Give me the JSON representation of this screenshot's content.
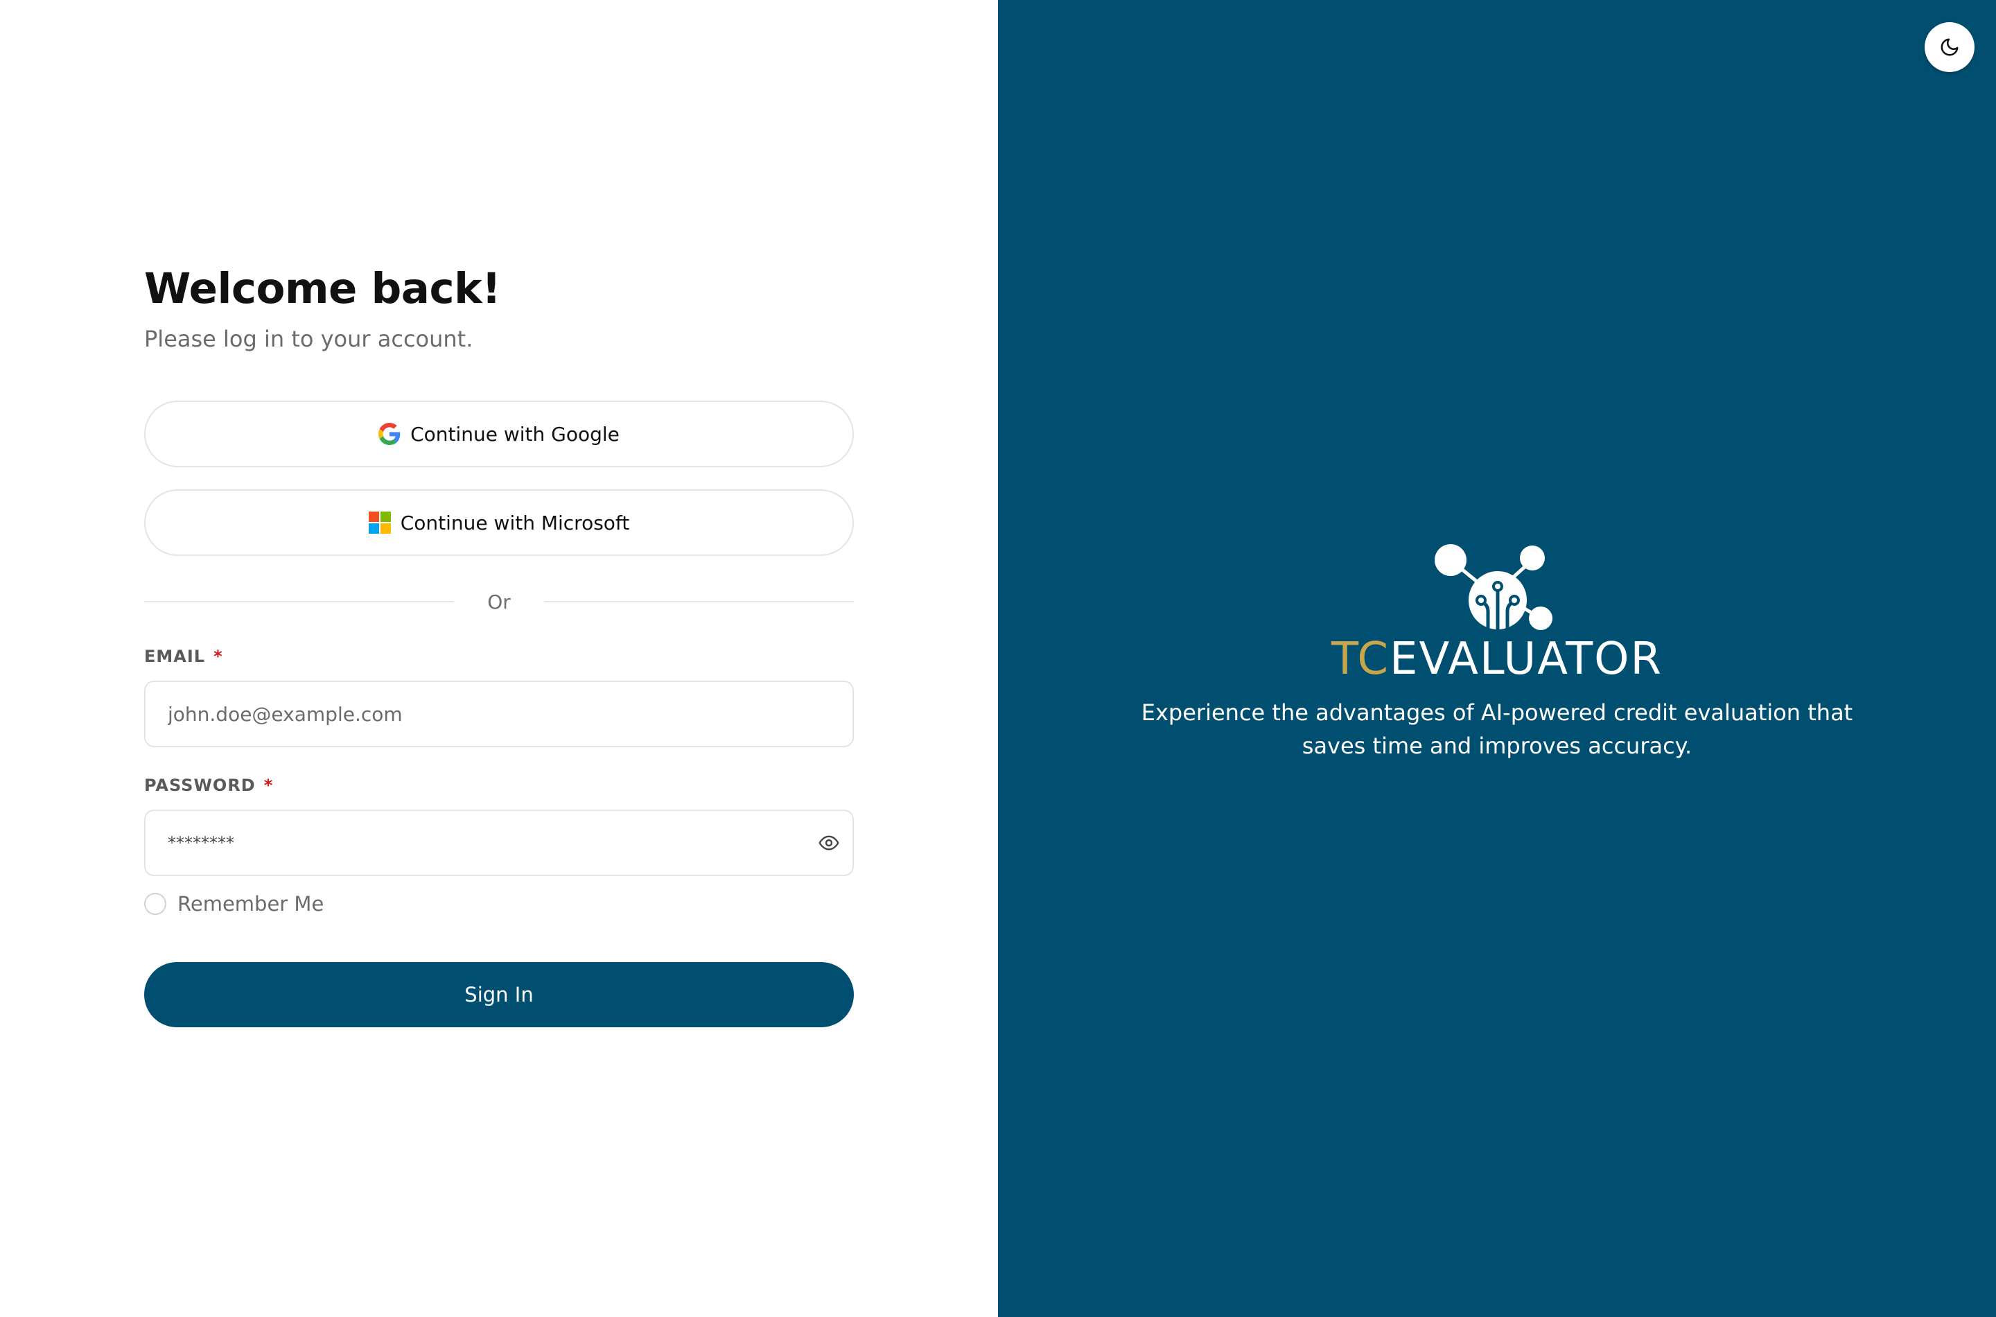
{
  "login": {
    "title": "Welcome back!",
    "subtitle": "Please log in to your account.",
    "google_button": "Continue with Google",
    "microsoft_button": "Continue with Microsoft",
    "divider_text": "Or",
    "email": {
      "label": "EMAIL",
      "required_marker": "*",
      "placeholder": "john.doe@example.com"
    },
    "password": {
      "label": "PASSWORD",
      "required_marker": "*",
      "value": "********"
    },
    "remember_me": "Remember Me",
    "sign_in_button": "Sign In"
  },
  "brand": {
    "wordmark_prefix": "TC",
    "wordmark_suffix": "EVALUATOR",
    "tagline_line1": "Experience the advantages of AI-powered credit evaluation that",
    "tagline_line2": "saves time and improves accuracy.",
    "background_color": "#004f71",
    "accent_gold": "#c9a64b"
  },
  "icons": {
    "google": "google-logo-icon",
    "microsoft": "microsoft-logo-icon",
    "password_toggle": "eye-icon",
    "theme_toggle": "moon-icon",
    "brand_logo": "network-circuit-logo"
  }
}
